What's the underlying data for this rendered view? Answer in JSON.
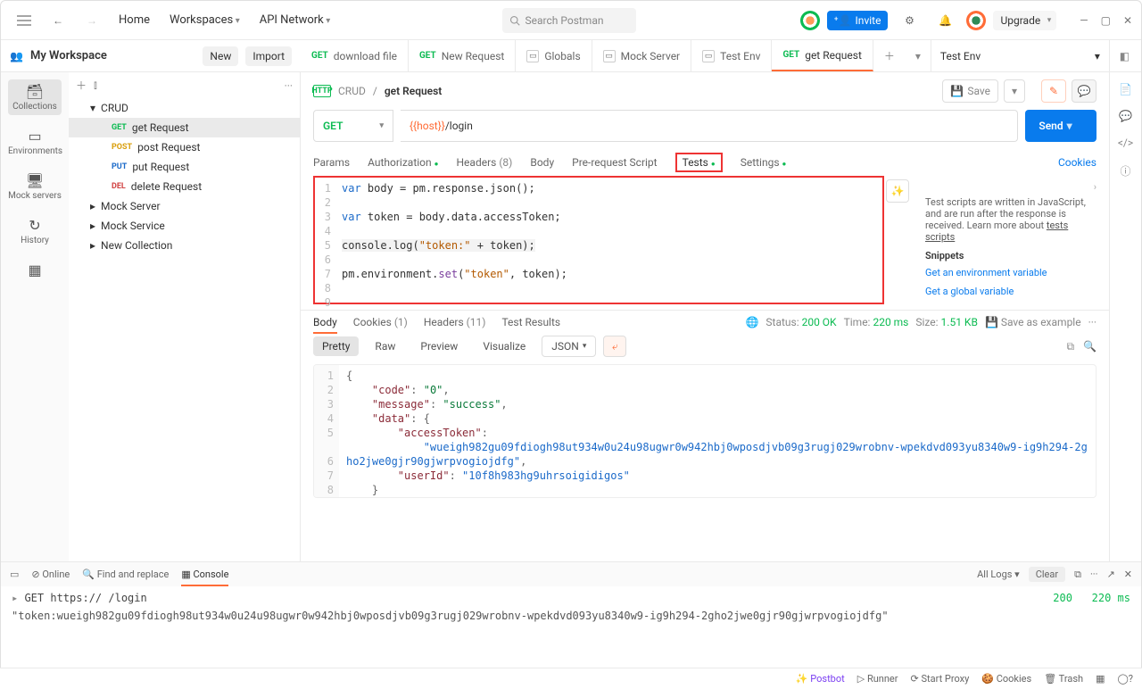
{
  "topbar": {
    "home": "Home",
    "workspaces": "Workspaces",
    "api_network": "API Network",
    "search_placeholder": "Search Postman",
    "invite": "Invite",
    "upgrade": "Upgrade"
  },
  "workspace": {
    "title": "My Workspace",
    "new_btn": "New",
    "import_btn": "Import"
  },
  "rail": {
    "collections": "Collections",
    "environments": "Environments",
    "mock": "Mock servers",
    "history": "History"
  },
  "sidebar": {
    "collection0": "CRUD",
    "items": [
      {
        "method": "GET",
        "label": "get Request"
      },
      {
        "method": "POST",
        "label": "post Request"
      },
      {
        "method": "PUT",
        "label": "put Request"
      },
      {
        "method": "DEL",
        "label": "delete Request"
      }
    ],
    "collection1": "Mock Server",
    "collection2": "Mock Service",
    "collection3": "New Collection"
  },
  "tabs": [
    {
      "method": "GET",
      "label": "download file",
      "active": false,
      "icon": null
    },
    {
      "method": "GET",
      "label": "New Request",
      "active": false,
      "icon": null
    },
    {
      "method": null,
      "label": "Globals",
      "active": false,
      "icon": "box"
    },
    {
      "method": null,
      "label": "Mock Server",
      "active": false,
      "icon": "box"
    },
    {
      "method": null,
      "label": "Test Env",
      "active": false,
      "icon": "box"
    },
    {
      "method": "GET",
      "label": "get Request",
      "active": true,
      "icon": null
    }
  ],
  "env": {
    "name": "Test Env"
  },
  "breadcrumb": {
    "collection": "CRUD",
    "sep": "/",
    "request": "get Request",
    "save": "Save"
  },
  "url": {
    "method": "GET",
    "host": "{{host}}",
    "path": "/login",
    "send": "Send"
  },
  "req_tabs": {
    "params": "Params",
    "auth": "Authorization",
    "headers": "Headers",
    "headers_count": "(8)",
    "body": "Body",
    "prereq": "Pre-request Script",
    "tests": "Tests",
    "settings": "Settings",
    "cookies": "Cookies"
  },
  "code": {
    "l1": "var body = pm.response.json();",
    "l2": "",
    "l3": "var token = body.data.accessToken;",
    "l4": "",
    "l5": "console.log(\"token:\" + token);",
    "l6": "",
    "l7": "pm.environment.set(\"token\", token);",
    "l8": "",
    "l9": ""
  },
  "helper": {
    "text": "Test scripts are written in JavaScript, and are run after the response is received. Learn more about",
    "link": "tests scripts",
    "snippets": "Snippets",
    "s1": "Get an environment variable",
    "s2": "Get a global variable"
  },
  "resp_tabs": {
    "body": "Body",
    "cookies": "Cookies",
    "cookies_n": "(1)",
    "headers": "Headers",
    "headers_n": "(11)",
    "tests": "Test Results"
  },
  "resp_meta": {
    "status_l": "Status:",
    "status": "200 OK",
    "time_l": "Time:",
    "time": "220 ms",
    "size_l": "Size:",
    "size": "1.51 KB",
    "save": "Save as example"
  },
  "body_view": {
    "pretty": "Pretty",
    "raw": "Raw",
    "preview": "Preview",
    "visualize": "Visualize",
    "json": "JSON"
  },
  "json": {
    "l1": "{",
    "l2_k": "\"code\"",
    "l2_v": "\"0\"",
    "l3_k": "\"message\"",
    "l3_v": "\"success\"",
    "l4_k": "\"data\"",
    "l5_k": "\"accessToken\"",
    "l5_v": "\"wueigh982gu09fdiogh98ut934w0u24u98ugwr0w942hbj0wposdjvb09g3rugj029wrobnv-wpekdvd093yu8340w9-ig9h294-2gho2jwe0gjr90gjwrpvogiojdfg\"",
    "l6_k": "\"userId\"",
    "l6_v": "\"10f8h983hg9uhrsoigidigos\"",
    "l7": "}",
    "l8": "}"
  },
  "console_bar": {
    "online": "Online",
    "find": "Find and replace",
    "console": "Console",
    "all_logs": "All Logs",
    "clear": "Clear"
  },
  "console": {
    "req": "GET https://                            /login",
    "status": "200",
    "time": "220 ms",
    "line2": "\"token:wueigh982gu09fdiogh98ut934w0u24u98ugwr0w942hbj0wposdjvb09g3rugj029wrobnv-wpekdvd093yu8340w9-ig9h294-2gho2jwe0gjr90gjwrpvogiojdfg\""
  },
  "footer": {
    "postbot": "Postbot",
    "runner": "Runner",
    "proxy": "Start Proxy",
    "cookies": "Cookies",
    "trash": "Trash"
  }
}
